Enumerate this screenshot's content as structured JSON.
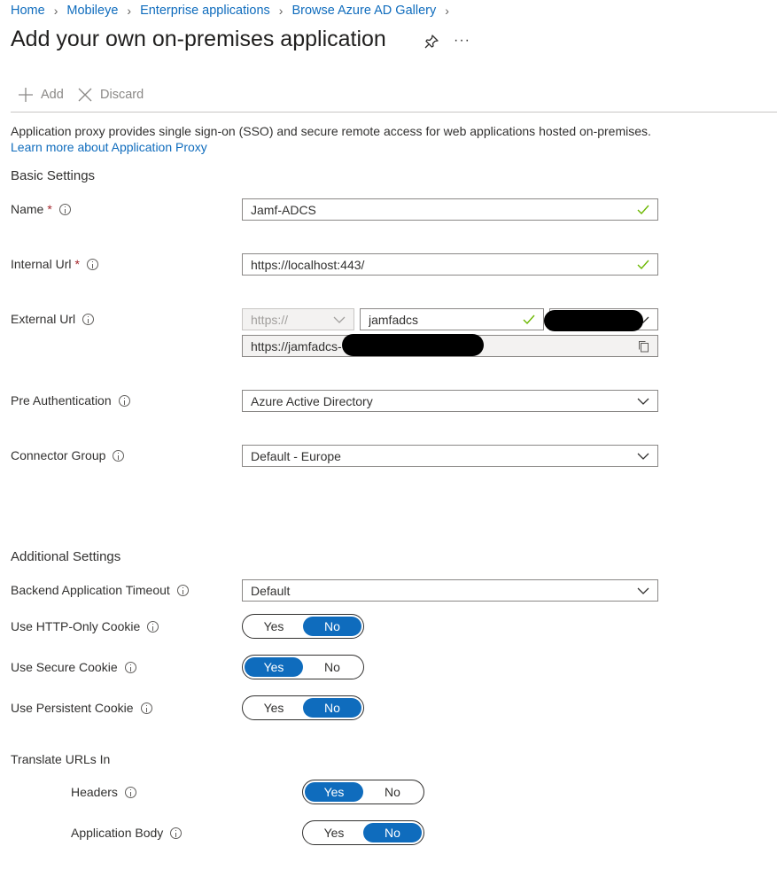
{
  "breadcrumb": [
    "Home",
    "Mobileye",
    "Enterprise applications",
    "Browse Azure AD Gallery"
  ],
  "page_title": "Add your own on-premises application",
  "toolbar": {
    "add_label": "Add",
    "discard_label": "Discard"
  },
  "intro": {
    "text": "Application proxy provides single sign-on (SSO) and secure remote access for web applications hosted on-premises. ",
    "link": "Learn more about Application Proxy"
  },
  "basic": {
    "heading": "Basic Settings",
    "name_label": "Name",
    "name_value": "Jamf-ADCS",
    "internal_url_label": "Internal Url",
    "internal_url_value": "https://localhost:443/",
    "external_url_label": "External Url",
    "external_scheme": "https://",
    "external_subdomain": "jamfadcs",
    "external_full": "https://jamfadcs-",
    "pre_auth_label": "Pre Authentication",
    "pre_auth_value": "Azure Active Directory",
    "connector_group_label": "Connector Group",
    "connector_group_value": "Default - Europe"
  },
  "additional": {
    "heading": "Additional Settings",
    "timeout_label": "Backend Application Timeout",
    "timeout_value": "Default",
    "http_only_label": "Use HTTP-Only Cookie",
    "secure_cookie_label": "Use Secure Cookie",
    "persistent_cookie_label": "Use Persistent Cookie",
    "translate_heading": "Translate URLs In",
    "headers_label": "Headers",
    "body_label": "Application Body"
  },
  "toggle_text": {
    "yes": "Yes",
    "no": "No"
  },
  "toggles": {
    "http_only": "No",
    "secure_cookie": "Yes",
    "persistent_cookie": "No",
    "headers": "Yes",
    "body": "No"
  },
  "colors": {
    "accent": "#0f6cbd",
    "valid_check": "#6bb700",
    "required": "#a4262c"
  }
}
